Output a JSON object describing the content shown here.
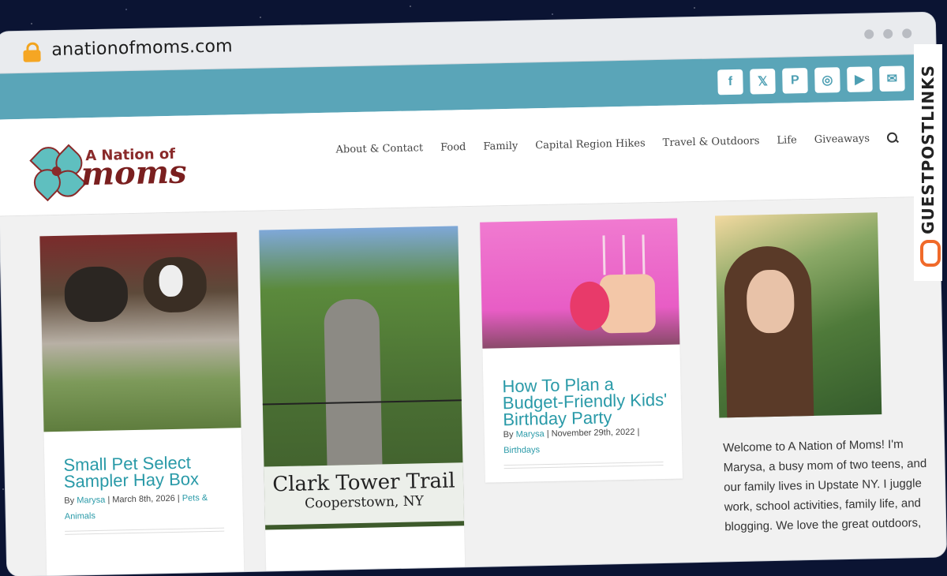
{
  "browser": {
    "url": "anationofmoms.com"
  },
  "social": [
    "facebook-icon",
    "x-icon",
    "pinterest-icon",
    "instagram-icon",
    "youtube-icon",
    "mail-icon"
  ],
  "logo": {
    "line1": "A Nation of",
    "line2": "moms"
  },
  "nav": [
    "About & Contact",
    "Food",
    "Family",
    "Capital Region Hikes",
    "Travel & Outdoors",
    "Life",
    "Giveaways"
  ],
  "posts": [
    {
      "title": "Small Pet Select Sampler Hay Box",
      "by": "By",
      "author": "Marysa",
      "date": "March 8th, 2026",
      "cat": "Pets & Animals"
    },
    {
      "image_caption": "Clark Tower Trail",
      "image_subcaption": "Cooperstown, NY"
    },
    {
      "title": "How To Plan a Budget-Friendly Kids' Birthday Party",
      "by": "By",
      "author": "Marysa",
      "date": "November 29th, 2022",
      "cat": "Birthdays"
    }
  ],
  "sidebar": {
    "welcome": "Welcome to A Nation of Moms! I'm Marysa, a busy mom of two teens, and our family lives in Upstate NY. I juggle work, school activities, family life, and blogging. We love the great outdoors,"
  },
  "watermark": {
    "text": "GUESTPOSTLINKS"
  },
  "colors": {
    "teal": "#5aa5b8",
    "brand": "#7a1f1f",
    "link": "#2a9aa8",
    "accent": "#f06a2a"
  }
}
